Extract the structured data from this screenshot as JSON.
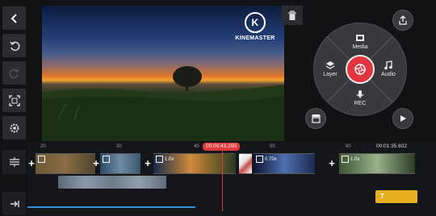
{
  "app": {
    "brand": "KINEMASTER"
  },
  "left_toolbar": [
    {
      "name": "back-button",
      "icon": "chevron-left-icon"
    },
    {
      "name": "undo-button",
      "icon": "undo-icon"
    },
    {
      "name": "redo-button",
      "icon": "redo-icon"
    },
    {
      "name": "fullscreen-button",
      "icon": "fullscreen-icon"
    },
    {
      "name": "settings-button",
      "icon": "gear-icon"
    }
  ],
  "media_wheel": {
    "media_label": "Media",
    "audio_label": "Audio",
    "rec_label": "REC",
    "layer_label": "Layer",
    "center_icon": "camera-shutter-icon"
  },
  "timeline": {
    "current_time": "00:00:43.200",
    "total_time": "00:01:35.602",
    "ruler_ticks": [
      "20",
      "30",
      "40",
      "50",
      "60"
    ],
    "clips": [
      {
        "speed": "",
        "colors": [
          "#6b5738",
          "#8a6d42",
          "#4d4330"
        ]
      },
      {
        "speed": "",
        "colors": [
          "#2a4a6a",
          "#6e8aa3",
          "#3c5670"
        ]
      },
      {
        "speed": "1.0x",
        "colors": [
          "#152a4a",
          "#d08a3a",
          "#27391f"
        ]
      },
      {
        "speed": "",
        "colors": [
          "#e8e4e4",
          "#c94b4b",
          "#ffffff"
        ]
      },
      {
        "speed": "0.70x",
        "colors": [
          "#0b1430",
          "#4f6fb0",
          "#1b2a50"
        ]
      },
      {
        "speed": "1.0x",
        "colors": [
          "#3e5530",
          "#9ab28a",
          "#2b3d24"
        ]
      }
    ],
    "text_clip_icon": "T"
  },
  "colors": {
    "accent": "#e3353f",
    "panel": "#2b2c30",
    "text_clip": "#e8b020"
  }
}
